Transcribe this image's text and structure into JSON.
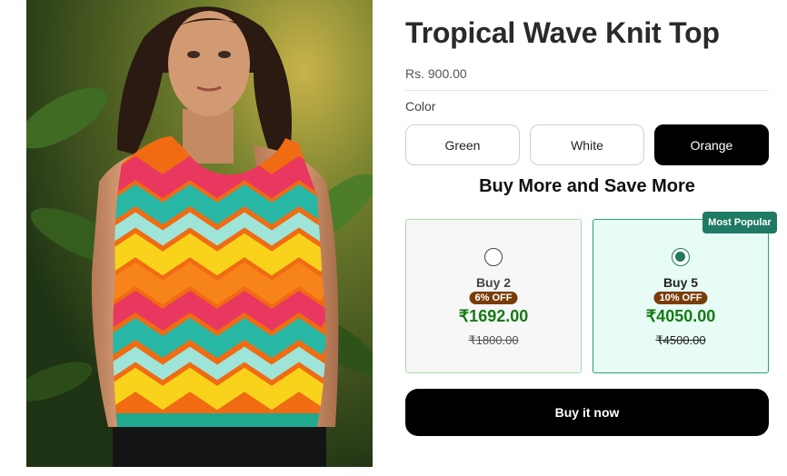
{
  "product": {
    "title": "Tropical Wave Knit Top",
    "price": "Rs. 900.00",
    "image_alt": "Model wearing multicolor zigzag knit tank top"
  },
  "color_selector": {
    "label": "Color",
    "options": [
      "Green",
      "White",
      "Orange"
    ],
    "selected": "Orange"
  },
  "bundles": {
    "heading": "Buy More and Save More",
    "popular_badge": "Most Popular",
    "offers": [
      {
        "label": "Buy 2",
        "discount": "6% OFF",
        "price": "₹1692.00",
        "compare_price": "₹1800.00",
        "selected": false
      },
      {
        "label": "Buy 5",
        "discount": "10% OFF",
        "price": "₹4050.00",
        "compare_price": "₹4500.00",
        "selected": true
      }
    ]
  },
  "actions": {
    "buy_now": "Buy it now"
  },
  "colors": {
    "accent_green": "#1e7a63",
    "price_green": "#157a15",
    "badge_brown": "#7a3d0a",
    "selected_card_bg": "#e6fcf4"
  }
}
